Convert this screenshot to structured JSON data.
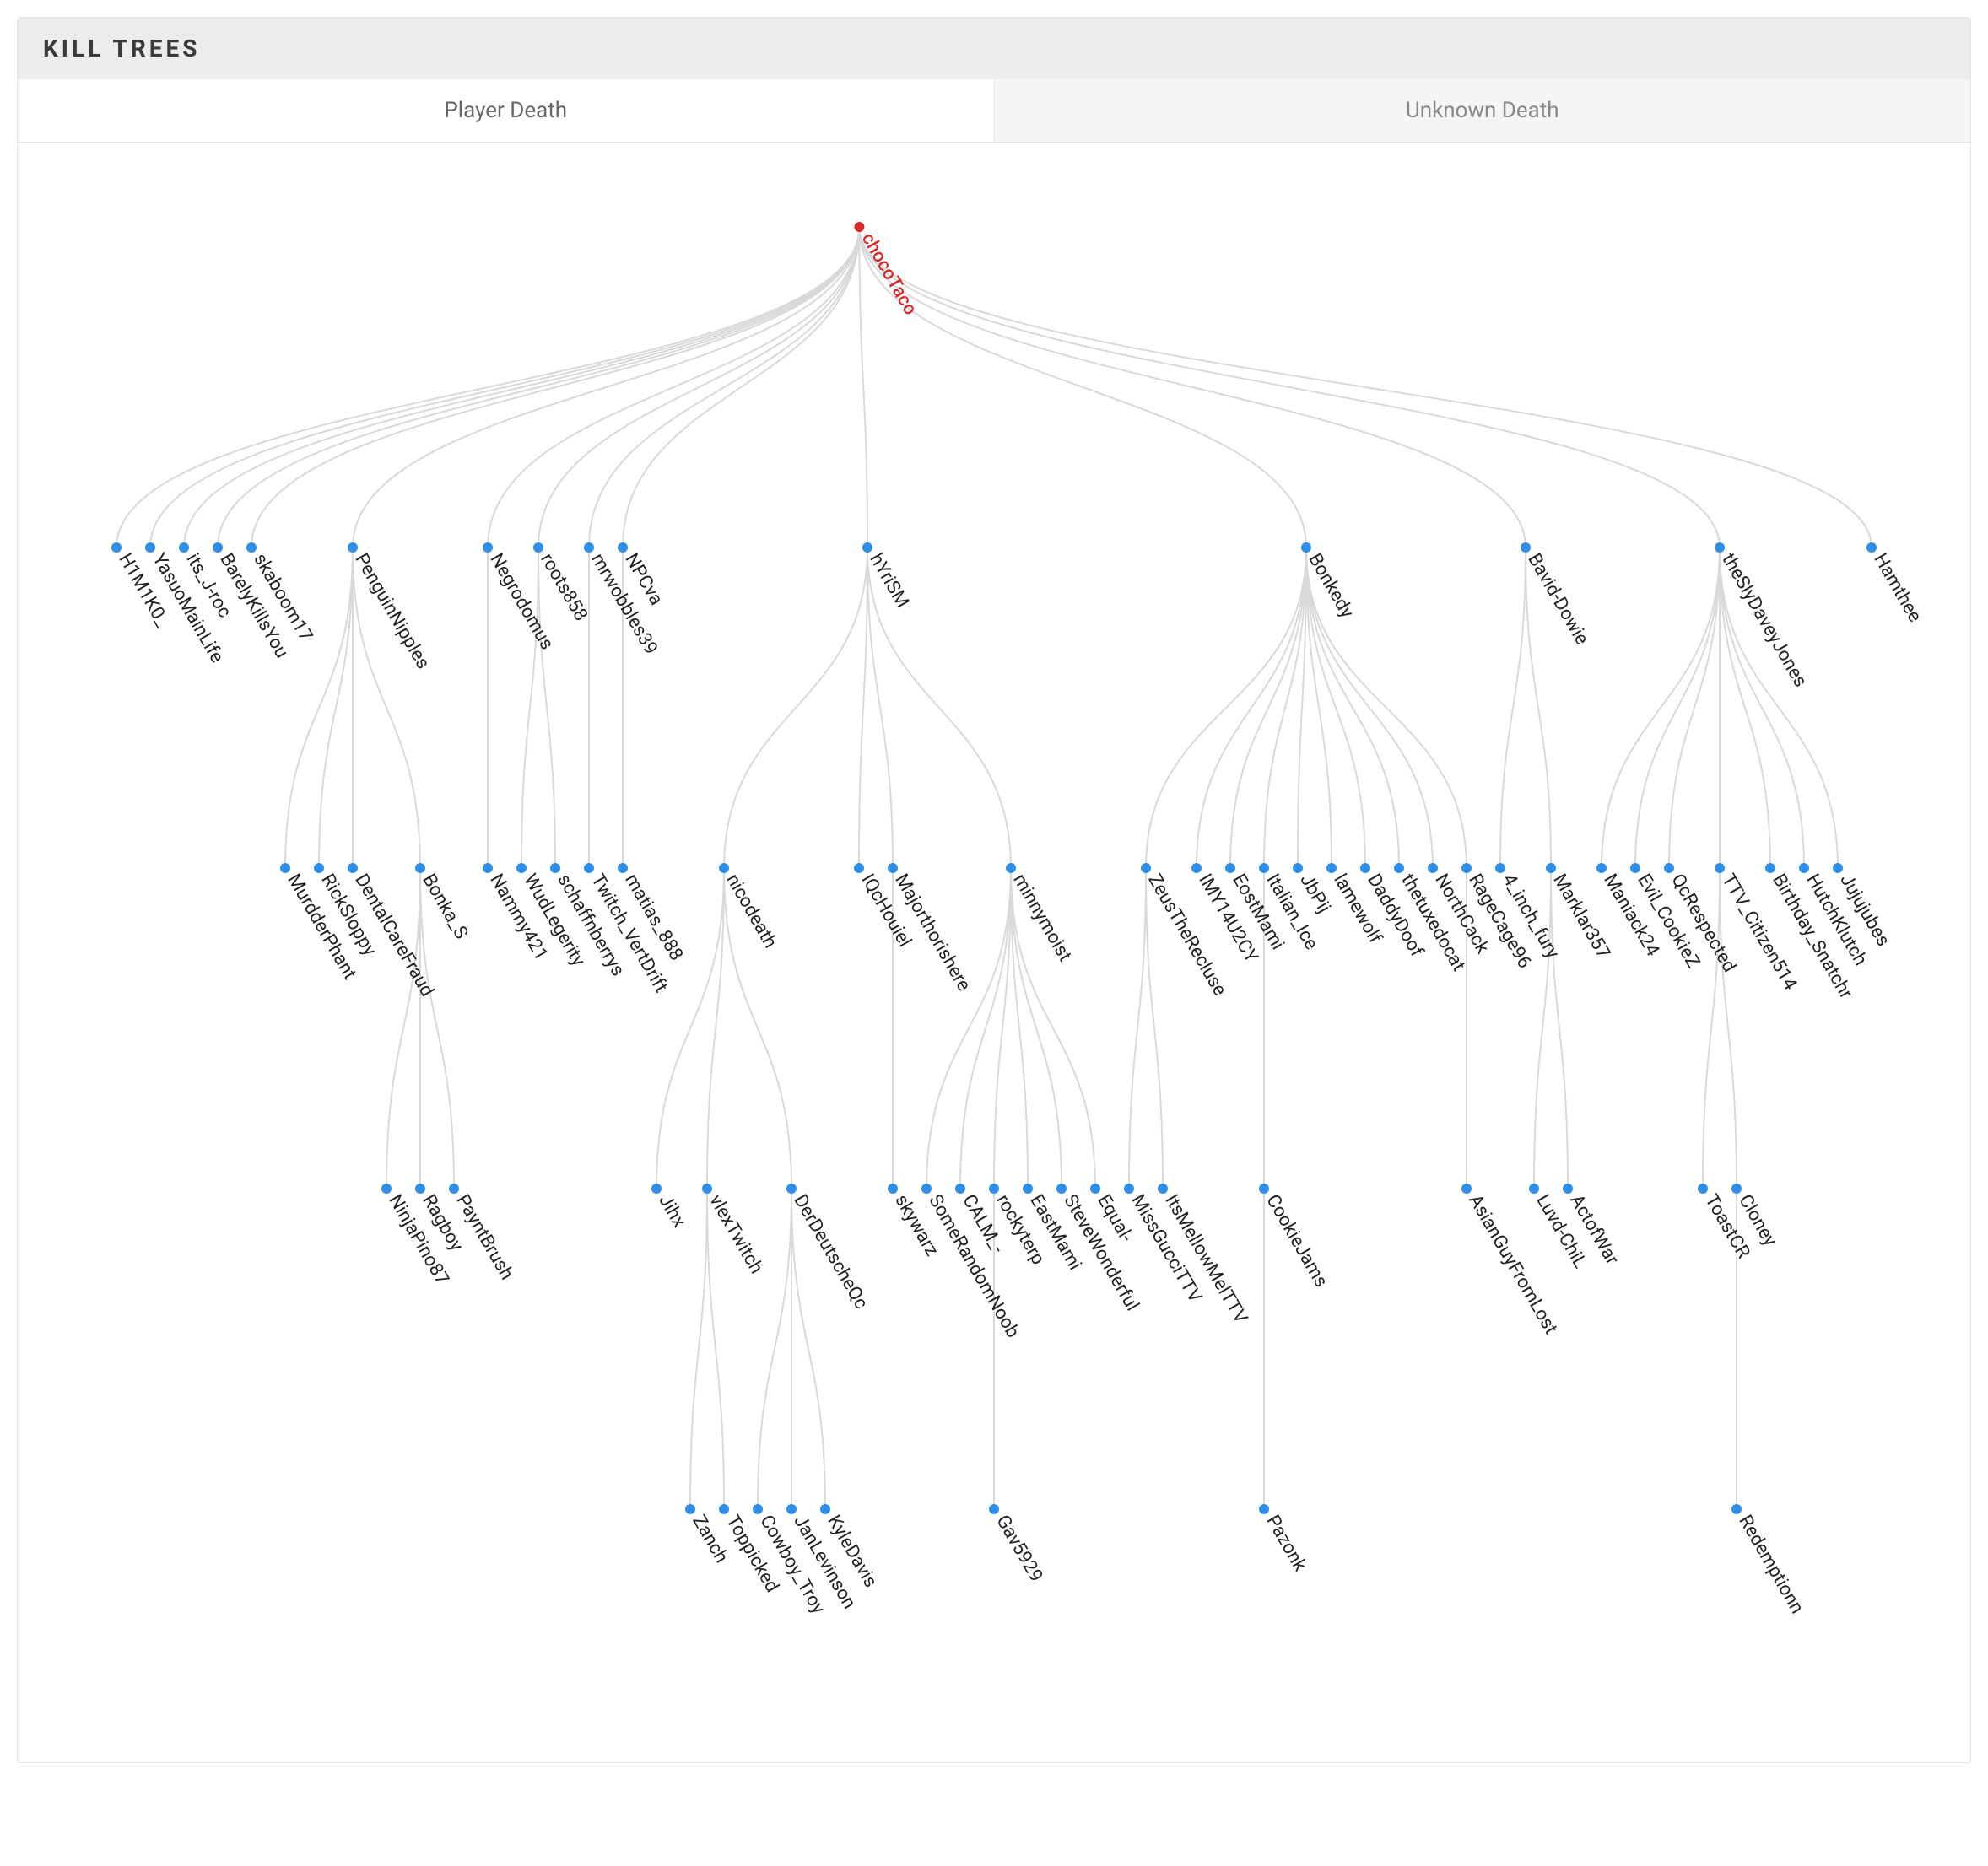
{
  "panel": {
    "title": "KILL TREES"
  },
  "tabs": [
    {
      "label": "Player Death",
      "active": true
    },
    {
      "label": "Unknown Death",
      "active": false
    }
  ],
  "tree": {
    "name": "chocoTaco",
    "children": [
      {
        "name": "H1M1K0_"
      },
      {
        "name": "YasuoMainLife"
      },
      {
        "name": "its_J-roc"
      },
      {
        "name": "BarelyKillsYou"
      },
      {
        "name": "skaboom17"
      },
      {
        "name": "PenguinNipples",
        "children": [
          {
            "name": "MurdderPhant"
          },
          {
            "name": "RickSloppy"
          },
          {
            "name": "DentalCareFraud"
          },
          {
            "name": "Bonka_S",
            "children": [
              {
                "name": "NinjaPino87"
              },
              {
                "name": "Ragboy"
              },
              {
                "name": "PayntBrush"
              }
            ]
          }
        ]
      },
      {
        "name": "Negrodomus",
        "children": [
          {
            "name": "Nammy421"
          }
        ]
      },
      {
        "name": "roots858",
        "children": [
          {
            "name": "WudLegerity"
          },
          {
            "name": "schaffnberrys"
          }
        ]
      },
      {
        "name": "mrwobbles39",
        "children": [
          {
            "name": "Twitch_VertDrift"
          }
        ]
      },
      {
        "name": "NPCva",
        "children": [
          {
            "name": "matias_888"
          }
        ]
      },
      {
        "name": "hYriSM",
        "children": [
          {
            "name": "nicodeath",
            "children": [
              {
                "name": "Jihx"
              },
              {
                "name": "vlexTwitch",
                "children": [
                  {
                    "name": "Zanch"
                  },
                  {
                    "name": "Toppicked"
                  }
                ]
              },
              {
                "name": "DerDeutscheQc",
                "children": [
                  {
                    "name": "Cowboy_Troy"
                  },
                  {
                    "name": "JanLevinson"
                  },
                  {
                    "name": "KyleDavis"
                  }
                ]
              }
            ]
          },
          {
            "name": "IQcHouiel"
          },
          {
            "name": "Majorthorishere",
            "children": [
              {
                "name": "skywarz"
              }
            ]
          },
          {
            "name": "minnymoist",
            "children": [
              {
                "name": "SomeRandomNoob"
              },
              {
                "name": "CALM_-"
              },
              {
                "name": "rockyterp",
                "children": [
                  {
                    "name": "Gav5929"
                  }
                ]
              },
              {
                "name": "EastMami"
              },
              {
                "name": "SteveWonderful"
              },
              {
                "name": "Equal-"
              }
            ]
          }
        ]
      },
      {
        "name": "Bonkedy",
        "children": [
          {
            "name": "ZeusTheRecluse",
            "children": [
              {
                "name": "MissGucciTTV"
              },
              {
                "name": "ItsMellowMelTTV"
              }
            ]
          },
          {
            "name": "IMY14U2CY"
          },
          {
            "name": "EostMami"
          },
          {
            "name": "Italian_Ice",
            "children": [
              {
                "name": "CookieJams",
                "children": [
                  {
                    "name": "Pazonk"
                  }
                ]
              }
            ]
          },
          {
            "name": "JbPij"
          },
          {
            "name": "lamewolf"
          },
          {
            "name": "DaddyDoof"
          },
          {
            "name": "thetuxedocat"
          },
          {
            "name": "NorthCack"
          },
          {
            "name": "RageCage96",
            "children": [
              {
                "name": "AsianGuyFromLost"
              }
            ]
          }
        ]
      },
      {
        "name": "Bavid-Dowie",
        "children": [
          {
            "name": "4_inch_fury"
          },
          {
            "name": "Marklar357",
            "children": [
              {
                "name": "Luvd-ChiL"
              },
              {
                "name": "ActofWar"
              }
            ]
          }
        ]
      },
      {
        "name": "theSlyDaveyJones",
        "children": [
          {
            "name": "Maniack24"
          },
          {
            "name": "Evil_CookieZ"
          },
          {
            "name": "QcRespected"
          },
          {
            "name": "TTV_Citizen514",
            "children": [
              {
                "name": "ToastCR"
              },
              {
                "name": "Cloney",
                "children": [
                  {
                    "name": "Redemptionn"
                  }
                ]
              }
            ]
          },
          {
            "name": "Birthday_Snatchr"
          },
          {
            "name": "HutchKlutch"
          },
          {
            "name": "Jujujubes"
          }
        ]
      },
      {
        "name": "Hamthee"
      }
    ]
  },
  "colors": {
    "root_node": "#d82a2a",
    "child_node": "#2d8fe8",
    "link": "#d9d9d9"
  }
}
